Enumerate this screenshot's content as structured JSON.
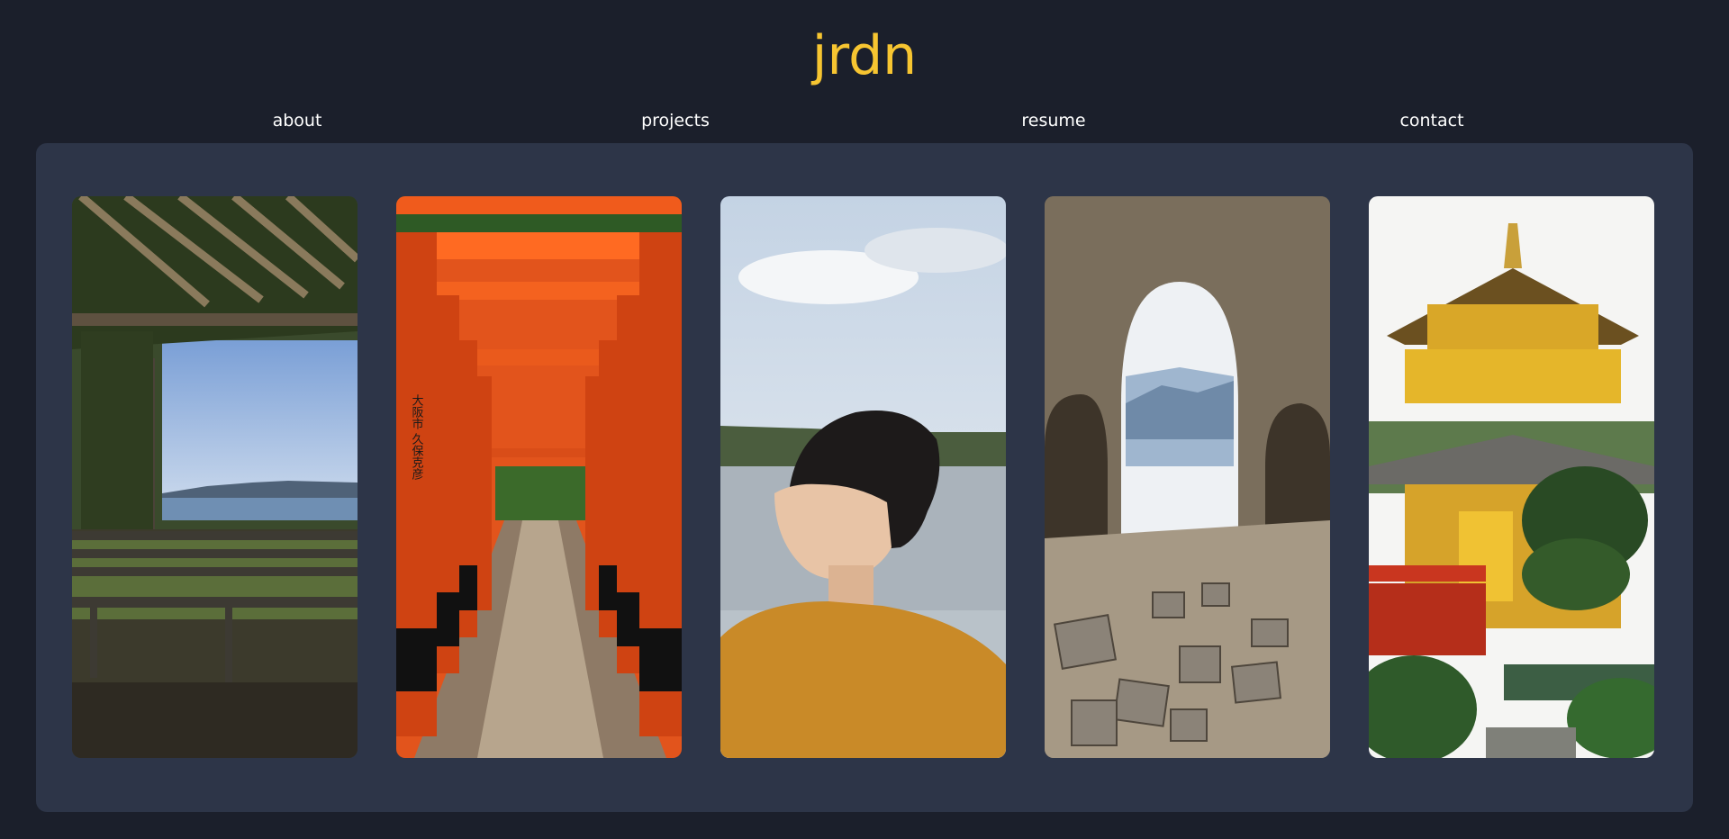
{
  "site": {
    "title": "jrdn"
  },
  "nav": {
    "items": [
      {
        "label": "about"
      },
      {
        "label": "projects"
      },
      {
        "label": "resume"
      },
      {
        "label": "contact"
      }
    ]
  },
  "gallery": {
    "photos": [
      {
        "icon": "pergola-bench-photo",
        "kanji": ""
      },
      {
        "icon": "torii-gates-photo",
        "kanji": "大阪市 久保克彦"
      },
      {
        "icon": "portrait-photo",
        "kanji": ""
      },
      {
        "icon": "stone-arch-ruins-photo",
        "kanji": ""
      },
      {
        "icon": "golden-pavilion-photo",
        "kanji": ""
      }
    ]
  },
  "colors": {
    "background": "#1b1f2b",
    "panel": "#2d3548",
    "accent": "#f7c531",
    "text": "#ffffff"
  }
}
